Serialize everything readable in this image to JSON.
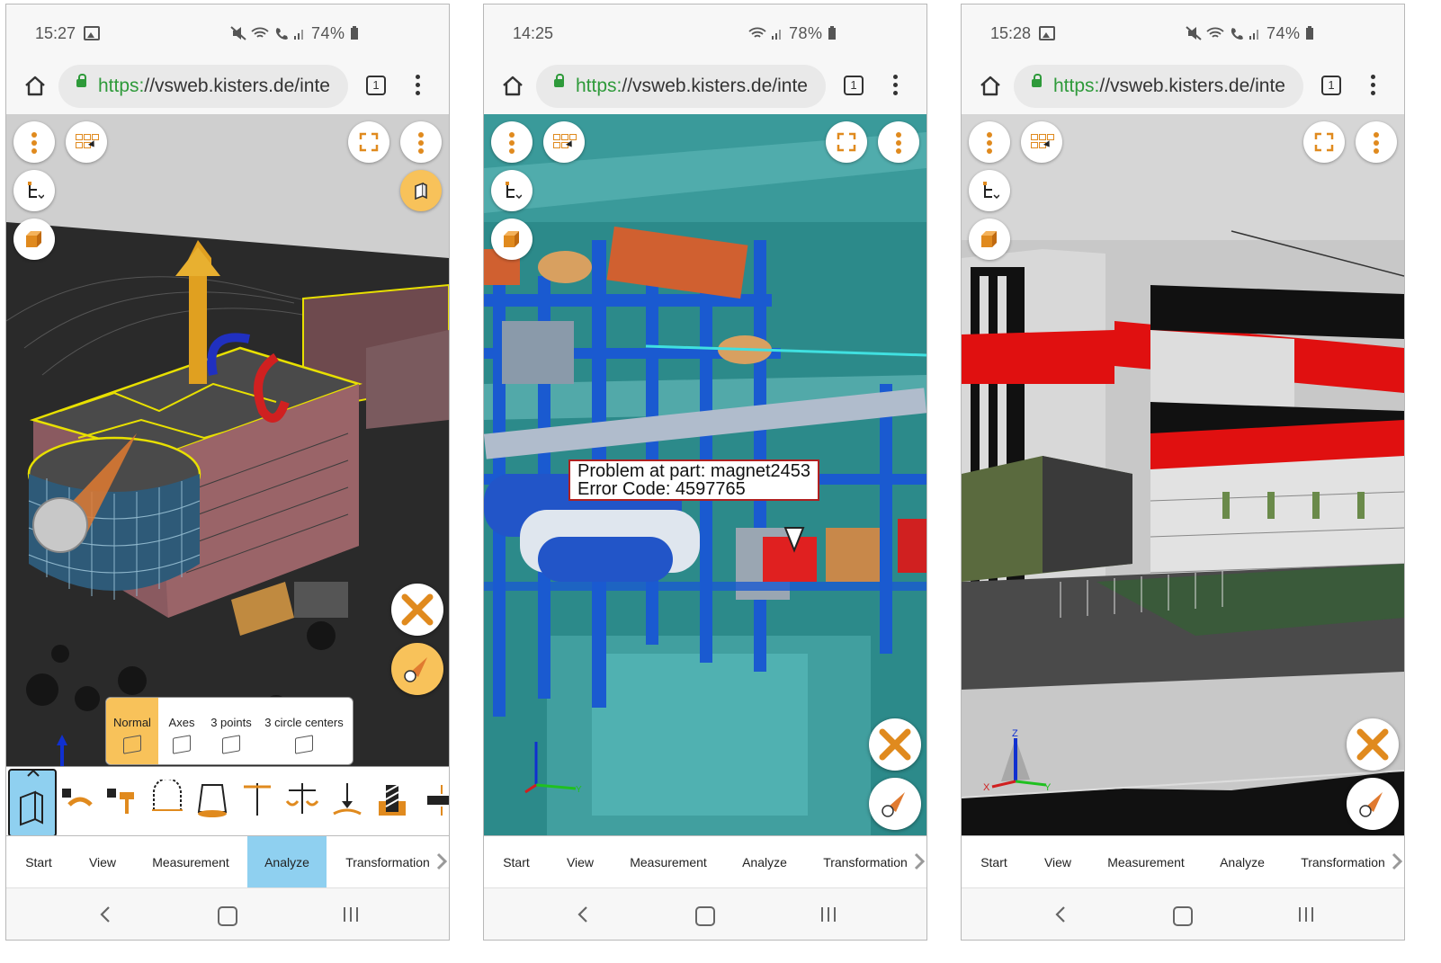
{
  "phones": [
    {
      "status": {
        "time": "15:27",
        "battery": "74%"
      },
      "url": {
        "scheme": "https:",
        "rest": "//vsweb.kisters.de/inte"
      },
      "tab_count": "1",
      "popup": {
        "options": [
          "Normal",
          "Axes",
          "3 points",
          "3 circle centers"
        ],
        "selected": "Normal"
      },
      "tabs": [
        "Start",
        "View",
        "Measurement",
        "Analyze",
        "Transformation"
      ],
      "active_tab": "Analyze"
    },
    {
      "status": {
        "time": "14:25",
        "battery": "78%"
      },
      "url": {
        "scheme": "https:",
        "rest": "//vsweb.kisters.de/inte"
      },
      "tab_count": "1",
      "tooltip": {
        "line1": "Problem at part: magnet2453",
        "line2": "Error Code: 4597765"
      },
      "tabs": [
        "Start",
        "View",
        "Measurement",
        "Analyze",
        "Transformation"
      ]
    },
    {
      "status": {
        "time": "15:28",
        "battery": "74%"
      },
      "url": {
        "scheme": "https:",
        "rest": "//vsweb.kisters.de/inte"
      },
      "tab_count": "1",
      "tabs": [
        "Start",
        "View",
        "Measurement",
        "Analyze",
        "Transformation"
      ]
    }
  ],
  "axis_labels": {
    "x": "X",
    "y": "Y",
    "z": "Z"
  },
  "colors": {
    "accent_orange": "#e08a1e",
    "fab_orange": "#f8c25a",
    "active_tab": "#8fd0f0",
    "url_green": "#2e9a3a"
  }
}
